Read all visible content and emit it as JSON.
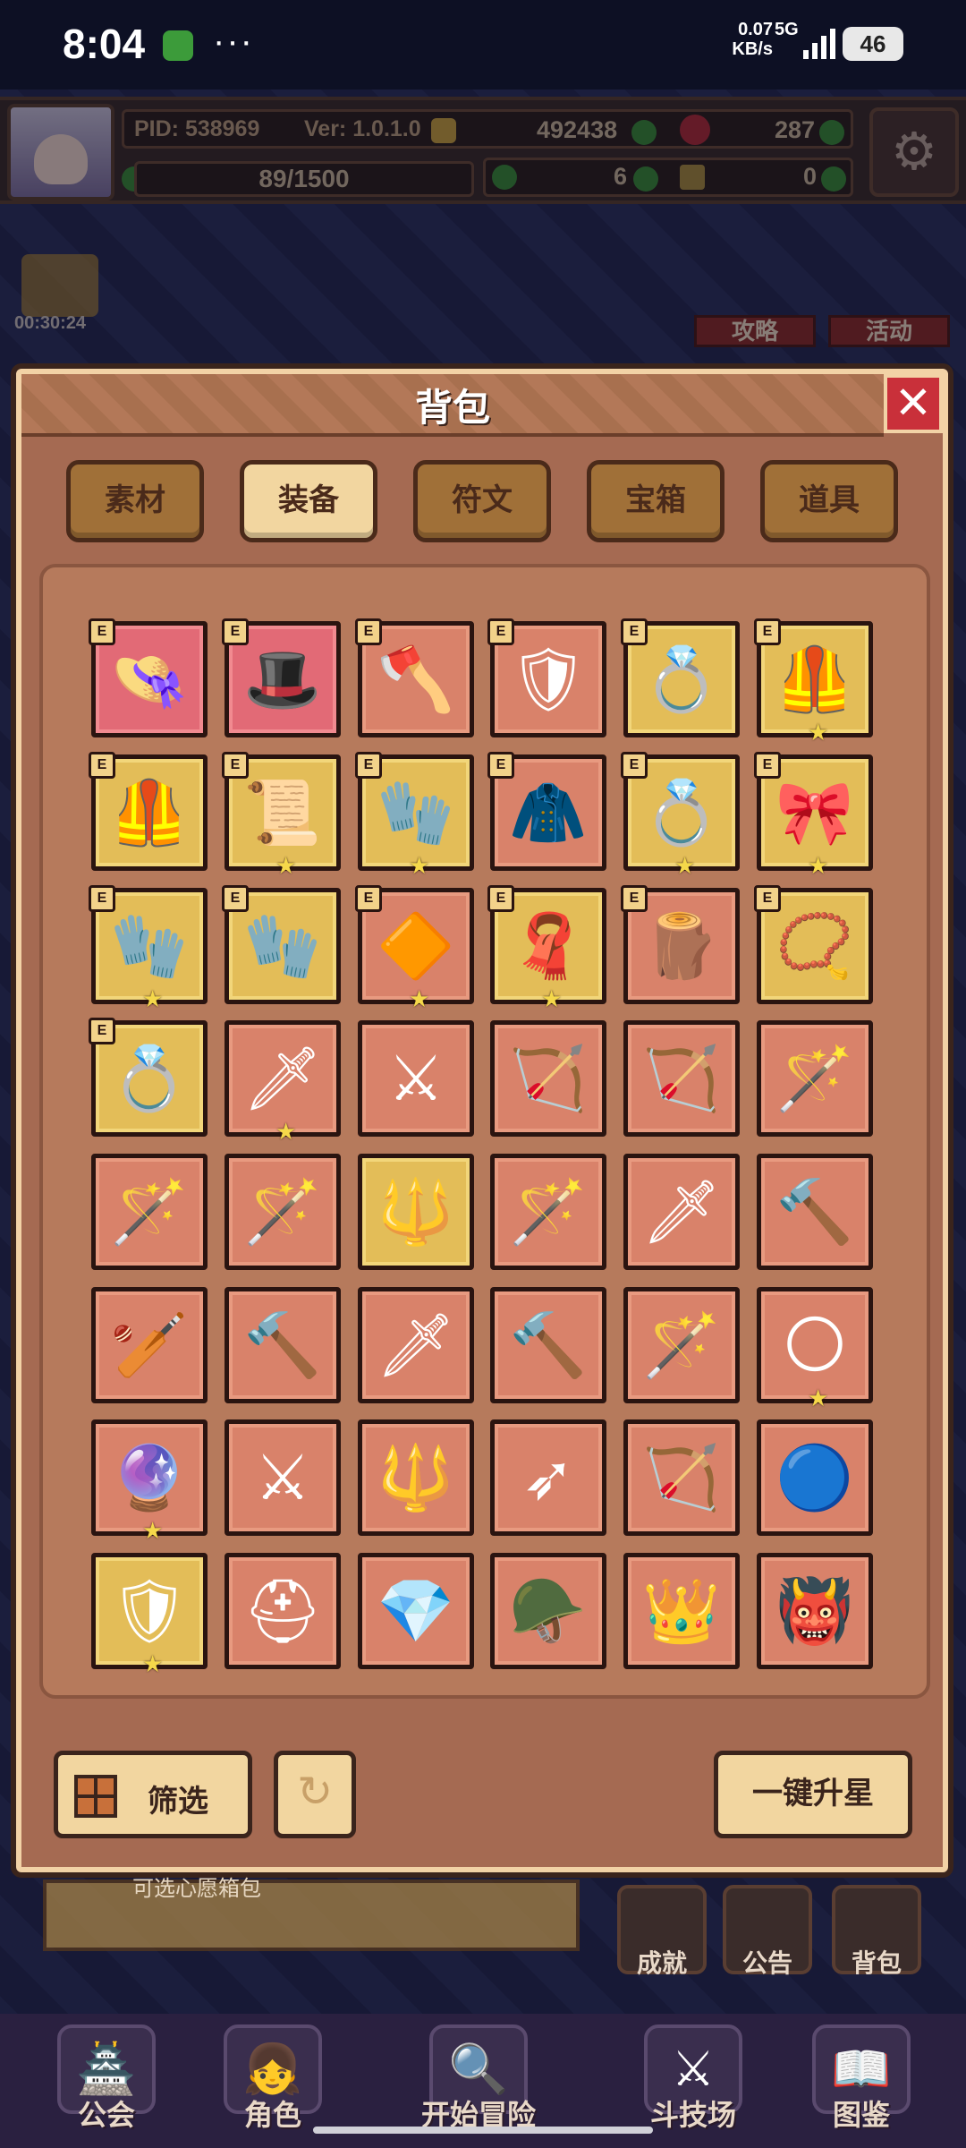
{
  "status_bar": {
    "time": "8:04",
    "more": "···",
    "speed": "0.07",
    "speed_unit": "KB/s",
    "network": "5G",
    "battery": "46"
  },
  "hud": {
    "pid": "PID: 538969",
    "version": "Ver: 1.0.1.0",
    "gold": "492438",
    "gems": "287",
    "exp": "89/1500",
    "clover": "6",
    "tickets": "0"
  },
  "side": {
    "timer": "00:30:24",
    "strategy": "攻略",
    "event": "活动"
  },
  "panel": {
    "title": "背包",
    "close": "✕",
    "tabs": [
      {
        "label": "素材",
        "active": false
      },
      {
        "label": "装备",
        "active": true
      },
      {
        "label": "符文",
        "active": false
      },
      {
        "label": "宝箱",
        "active": false
      },
      {
        "label": "道具",
        "active": false
      }
    ],
    "filter": "筛选",
    "upstar": "一键升星",
    "eq_badge": "E"
  },
  "items": [
    {
      "icon": "straw-hat-icon",
      "glyph": "👒",
      "bg": "pink",
      "equipped": true,
      "star": false
    },
    {
      "icon": "red-hat-icon",
      "glyph": "🎩",
      "bg": "pink",
      "equipped": true,
      "star": false
    },
    {
      "icon": "axe-icon",
      "glyph": "🪓",
      "bg": "orange",
      "equipped": true,
      "star": false
    },
    {
      "icon": "shield-armor-icon",
      "glyph": "🛡",
      "bg": "orange",
      "equipped": true,
      "star": false
    },
    {
      "icon": "gold-ring-icon",
      "glyph": "💍",
      "bg": "gold",
      "equipped": true,
      "star": false
    },
    {
      "icon": "gold-armor-icon",
      "glyph": "🦺",
      "bg": "gold",
      "equipped": true,
      "star": true
    },
    {
      "icon": "leather-armor-icon",
      "glyph": "🦺",
      "bg": "gold",
      "equipped": true,
      "star": false
    },
    {
      "icon": "scroll-icon",
      "glyph": "📜",
      "bg": "gold",
      "equipped": true,
      "star": true
    },
    {
      "icon": "red-gauntlet-icon",
      "glyph": "🧤",
      "bg": "gold",
      "equipped": true,
      "star": true
    },
    {
      "icon": "white-cape-icon",
      "glyph": "🧥",
      "bg": "orange",
      "equipped": true,
      "star": false
    },
    {
      "icon": "gem-ring-icon",
      "glyph": "💍",
      "bg": "gold",
      "equipped": true,
      "star": true
    },
    {
      "icon": "red-pauldron-icon",
      "glyph": "🎀",
      "bg": "gold",
      "equipped": true,
      "star": true
    },
    {
      "icon": "gold-gloves-icon",
      "glyph": "🧤",
      "bg": "gold",
      "equipped": true,
      "star": true
    },
    {
      "icon": "green-gloves-icon",
      "glyph": "🧤",
      "bg": "gold",
      "equipped": true,
      "star": false
    },
    {
      "icon": "fire-amulet-icon",
      "glyph": "🔶",
      "bg": "orange",
      "equipped": true,
      "star": true
    },
    {
      "icon": "gold-cloak-icon",
      "glyph": "🧣",
      "bg": "gold",
      "equipped": true,
      "star": true
    },
    {
      "icon": "wooden-shield-icon",
      "glyph": "🪵",
      "bg": "orange",
      "equipped": true,
      "star": false
    },
    {
      "icon": "gold-necklace-icon",
      "glyph": "📿",
      "bg": "gold",
      "equipped": true,
      "star": false
    },
    {
      "icon": "gold-bracelet-icon",
      "glyph": "💍",
      "bg": "gold",
      "equipped": true,
      "star": false
    },
    {
      "icon": "dark-sword-icon",
      "glyph": "🗡",
      "bg": "orange",
      "equipped": false,
      "star": true
    },
    {
      "icon": "crossed-swords-icon",
      "glyph": "⚔",
      "bg": "orange",
      "equipped": false,
      "star": false
    },
    {
      "icon": "green-bow-icon",
      "glyph": "🏹",
      "bg": "orange",
      "equipped": false,
      "star": false
    },
    {
      "icon": "crossbow-icon",
      "glyph": "🏹",
      "bg": "orange",
      "equipped": false,
      "star": false
    },
    {
      "icon": "ice-wand-icon",
      "glyph": "🪄",
      "bg": "orange",
      "equipped": false,
      "star": false
    },
    {
      "icon": "wooden-staff-icon",
      "glyph": "🪄",
      "bg": "orange",
      "equipped": false,
      "star": false
    },
    {
      "icon": "blue-orb-staff-icon",
      "glyph": "🪄",
      "bg": "orange",
      "equipped": false,
      "star": false
    },
    {
      "icon": "gold-spear-icon",
      "glyph": "🔱",
      "bg": "gold",
      "equipped": false,
      "star": false
    },
    {
      "icon": "claw-staff-icon",
      "glyph": "🪄",
      "bg": "orange",
      "equipped": false,
      "star": false
    },
    {
      "icon": "dagger-icon",
      "glyph": "🗡",
      "bg": "orange",
      "equipped": false,
      "star": false
    },
    {
      "icon": "gold-mace-icon",
      "glyph": "🔨",
      "bg": "orange",
      "equipped": false,
      "star": false
    },
    {
      "icon": "cyan-club-icon",
      "glyph": "🏏",
      "bg": "orange",
      "equipped": false,
      "star": false
    },
    {
      "icon": "crystal-mace-icon",
      "glyph": "🔨",
      "bg": "orange",
      "equipped": false,
      "star": false
    },
    {
      "icon": "broad-sword-icon",
      "glyph": "🗡",
      "bg": "orange",
      "equipped": false,
      "star": false
    },
    {
      "icon": "spiked-mace-icon",
      "glyph": "🔨",
      "bg": "orange",
      "equipped": false,
      "star": false
    },
    {
      "icon": "sapphire-scepter-icon",
      "glyph": "🪄",
      "bg": "orange",
      "equipped": false,
      "star": false
    },
    {
      "icon": "moon-orb-icon",
      "glyph": "🌕",
      "bg": "orange",
      "equipped": false,
      "star": true
    },
    {
      "icon": "teal-orb-icon",
      "glyph": "🔮",
      "bg": "orange",
      "equipped": false,
      "star": true
    },
    {
      "icon": "twin-blades-icon",
      "glyph": "⚔",
      "bg": "orange",
      "equipped": false,
      "star": false
    },
    {
      "icon": "green-spear-icon",
      "glyph": "🔱",
      "bg": "orange",
      "equipped": false,
      "star": false
    },
    {
      "icon": "gold-arrow-icon",
      "glyph": "➶",
      "bg": "orange",
      "equipped": false,
      "star": false
    },
    {
      "icon": "purple-crossbow-icon",
      "glyph": "🏹",
      "bg": "orange",
      "equipped": false,
      "star": false
    },
    {
      "icon": "blue-orb-icon",
      "glyph": "🔵",
      "bg": "orange",
      "equipped": false,
      "star": false
    },
    {
      "icon": "ornate-shield-icon",
      "glyph": "🛡",
      "bg": "gold",
      "equipped": false,
      "star": true
    },
    {
      "icon": "green-helmet-icon",
      "glyph": "⛑",
      "bg": "orange",
      "equipped": false,
      "star": false
    },
    {
      "icon": "crystal-helm-icon",
      "glyph": "💎",
      "bg": "orange",
      "equipped": false,
      "star": false
    },
    {
      "icon": "winged-helmet-icon",
      "glyph": "🪖",
      "bg": "orange",
      "equipped": false,
      "star": false
    },
    {
      "icon": "gold-crown-icon",
      "glyph": "👑",
      "bg": "orange",
      "equipped": false,
      "star": false
    },
    {
      "icon": "demon-helmet-icon",
      "glyph": "👹",
      "bg": "orange",
      "equipped": false,
      "star": false
    }
  ],
  "below": {
    "news": "可选心愿箱包",
    "achievements": "成就",
    "notice": "公告",
    "bag": "背包"
  },
  "nav": [
    {
      "label": "公会",
      "glyph": "🏯"
    },
    {
      "label": "角色",
      "glyph": "👧"
    },
    {
      "label": "开始冒险",
      "glyph": "🔍"
    },
    {
      "label": "斗技场",
      "glyph": "⚔"
    },
    {
      "label": "图鉴",
      "glyph": "📖"
    }
  ],
  "colors": {
    "panel": "#a56a52",
    "tab_active": "#f2d6a0",
    "slot_orange": "#d9826a",
    "slot_gold": "#e3bd58",
    "slot_pink": "#e26a76",
    "close": "#c9303a"
  }
}
